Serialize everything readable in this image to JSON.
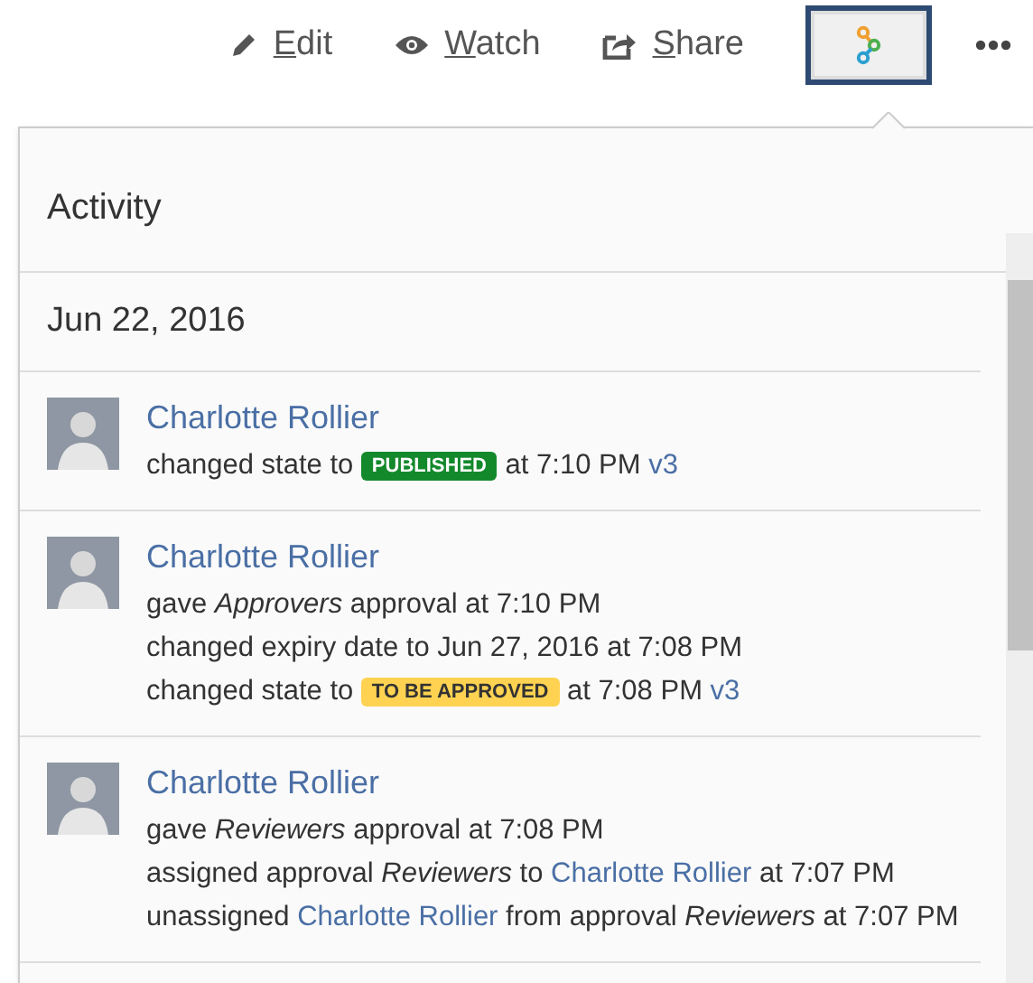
{
  "toolbar": [
    {
      "kind": "labeled",
      "label": "Edit"
    },
    {
      "kind": "labeled",
      "label": "Watch"
    },
    {
      "kind": "labeled",
      "label": "Share"
    },
    {
      "kind": "toggle",
      "selected": true
    },
    {
      "kind": "more"
    }
  ],
  "activity": {
    "title": "Activity",
    "date": "Jun 22, 2016",
    "entries": [
      {
        "author": "Charlotte Rollier",
        "lines": [
          [
            {
              "kind": "text",
              "text": "changed state to "
            },
            {
              "kind": "badge",
              "text": "PUBLISHED",
              "color": "#14892c"
            },
            {
              "kind": "text",
              "text": " at 7:10 PM "
            },
            {
              "kind": "link",
              "text": "v3"
            }
          ]
        ]
      },
      {
        "author": "Charlotte Rollier",
        "lines": [
          [
            {
              "kind": "text",
              "text": "gave *Approvers* approval at 7:10 PM"
            }
          ],
          [
            {
              "kind": "text",
              "text": "changed expiry date to Jun 27, 2016 at 7:08 PM"
            }
          ],
          [
            {
              "kind": "text",
              "text": "changed state to "
            },
            {
              "kind": "badge",
              "text": "TO BE APPROVED",
              "color": "#ffd351"
            },
            {
              "kind": "text",
              "text": " at 7:08 PM "
            },
            {
              "kind": "link",
              "text": "v3"
            }
          ]
        ]
      },
      {
        "author": "Charlotte Rollier",
        "lines": [
          [
            {
              "kind": "text",
              "text": "gave *Reviewers* approval at 7:08 PM"
            }
          ],
          [
            {
              "kind": "text",
              "text": "assigned approval *Reviewers* to "
            },
            {
              "kind": "link",
              "text": "Charlotte Rollier"
            },
            {
              "kind": "text",
              "text": " at 7:07 PM"
            }
          ],
          [
            {
              "kind": "text",
              "text": "unassigned "
            },
            {
              "kind": "link",
              "text": "Charlotte Rollier"
            },
            {
              "kind": "text",
              "text": " from approval *Reviewers* at 7:07 PM"
            }
          ]
        ]
      }
    ]
  }
}
